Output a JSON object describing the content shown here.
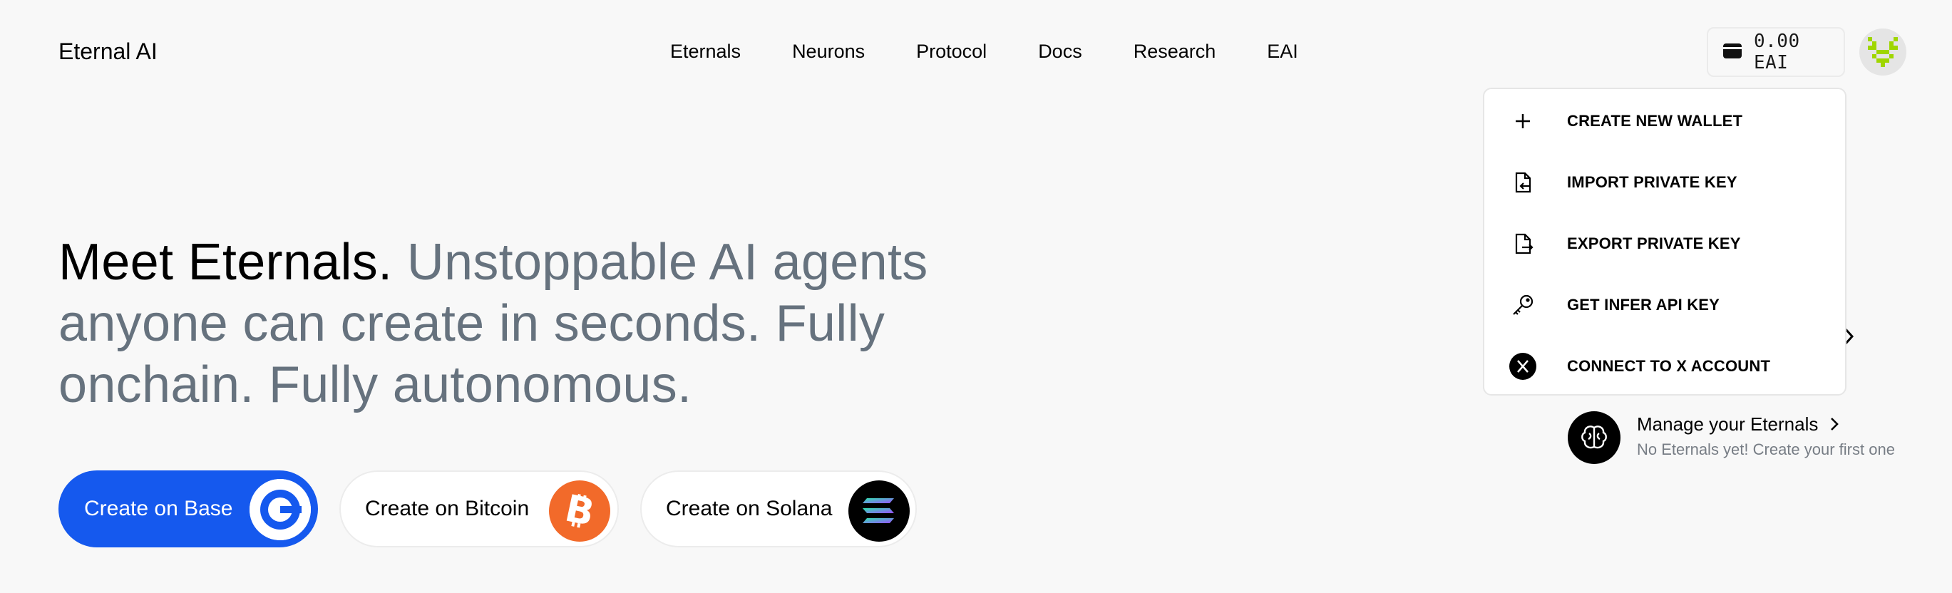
{
  "header": {
    "logo": "Eternal AI",
    "nav": [
      "Eternals",
      "Neurons",
      "Protocol",
      "Docs",
      "Research",
      "EAI"
    ],
    "wallet_balance": "0.00 EAI",
    "wallet_icon": "wallet-icon",
    "avatar_icon": "pixel-avatar-icon"
  },
  "dropdown": {
    "items": [
      {
        "label": "CREATE NEW WALLET",
        "icon": "plus-icon"
      },
      {
        "label": "IMPORT PRIVATE KEY",
        "icon": "file-import-icon"
      },
      {
        "label": "EXPORT PRIVATE KEY",
        "icon": "file-export-icon"
      },
      {
        "label": "GET INFER API KEY",
        "icon": "key-icon"
      },
      {
        "label": "CONNECT TO X ACCOUNT",
        "icon": "x-logo-icon"
      }
    ]
  },
  "hero": {
    "headline_strong": "Meet Eternals.",
    "headline_rest": "Unstoppable AI agents anyone can create in seconds. Fully onchain. Fully autonomous."
  },
  "create_buttons": [
    {
      "label": "Create on Base",
      "icon": "base-logo-icon"
    },
    {
      "label": "Create on Bitcoin",
      "icon": "bitcoin-logo-icon"
    },
    {
      "label": "Create on Solana",
      "icon": "solana-logo-icon"
    }
  ],
  "manage": {
    "title": "Manage your Eternals",
    "subtitle": "No Eternals yet! Create your first one",
    "icon": "brain-icon"
  },
  "colors": {
    "background": "#f8f8f8",
    "base_blue": "#1559ee",
    "bitcoin_orange": "#f26a2a",
    "muted_text": "#66727e",
    "avatar_green": "#9fd600"
  }
}
